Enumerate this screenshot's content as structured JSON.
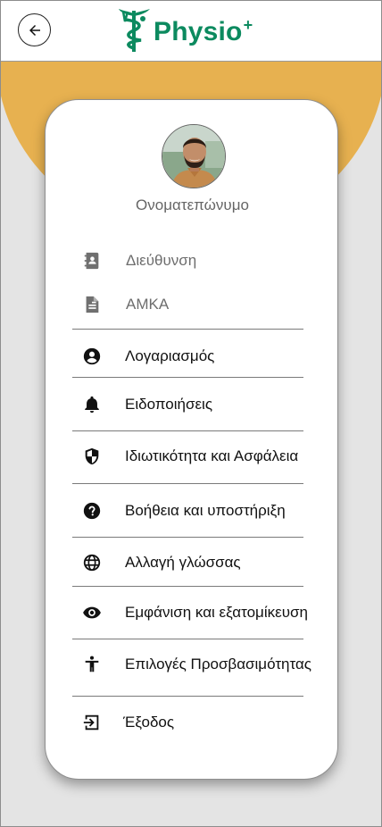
{
  "header": {
    "logo_text": "Physio",
    "logo_sup": "+"
  },
  "profile": {
    "name": "Ονοματεπώνυμο"
  },
  "info": {
    "address_label": "Διεύθυνση",
    "amka_label": "ΑΜΚΑ"
  },
  "menu": {
    "account": "Λογαριασμός",
    "notifications": "Ειδοποιήσεις",
    "privacy": "Ιδιωτικότητα και Ασφάλεια",
    "help": "Βοήθεια και υποστήριξη",
    "language": "Αλλαγή γλώσσας",
    "appearance": "Εμφάνιση και εξατομίκευση",
    "accessibility": "Επιλογές Προσβασιμότητας",
    "logout": "Έξοδος"
  },
  "colors": {
    "brand": "#0c8a5f",
    "accent": "#e7b150"
  }
}
